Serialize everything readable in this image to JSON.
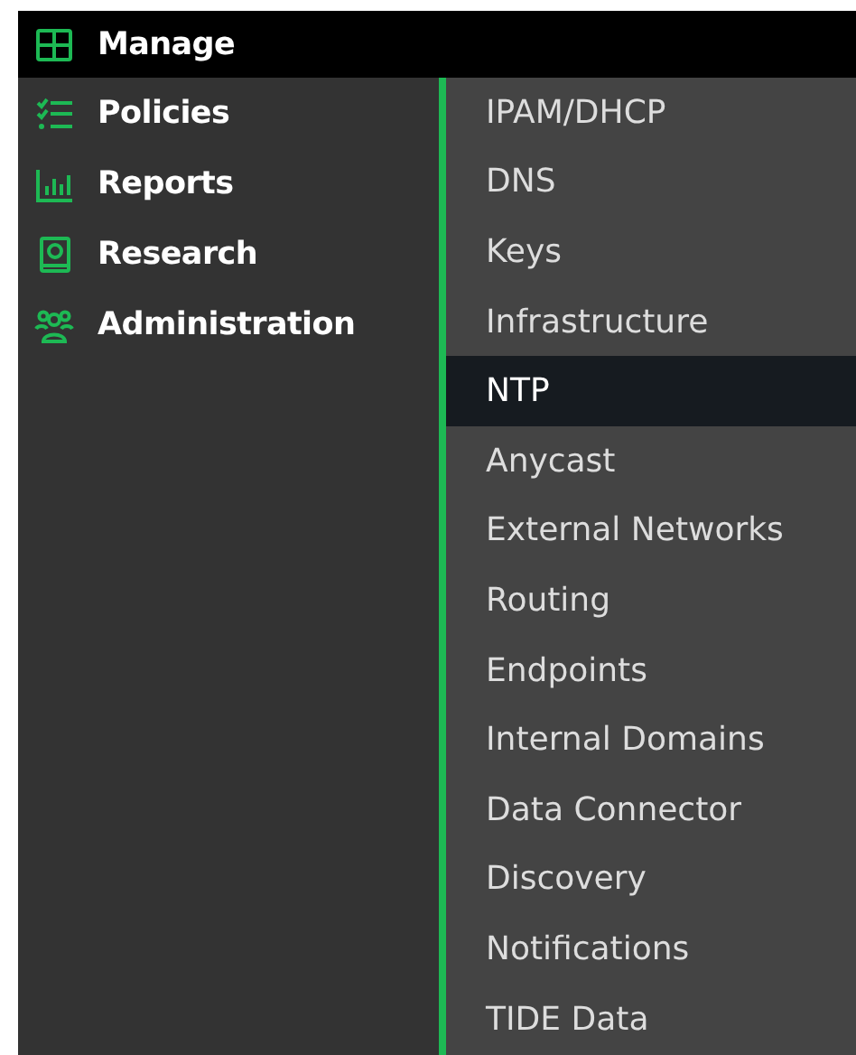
{
  "sidebar": {
    "items": [
      {
        "label": "Manage",
        "selected": true
      },
      {
        "label": "Policies",
        "selected": false
      },
      {
        "label": "Reports",
        "selected": false
      },
      {
        "label": "Research",
        "selected": false
      },
      {
        "label": "Administration",
        "selected": false
      }
    ]
  },
  "submenu": {
    "items": [
      {
        "label": "IPAM/DHCP",
        "selected": false
      },
      {
        "label": "DNS",
        "selected": false
      },
      {
        "label": "Keys",
        "selected": false
      },
      {
        "label": "Infrastructure",
        "selected": false
      },
      {
        "label": "NTP",
        "selected": true
      },
      {
        "label": "Anycast",
        "selected": false
      },
      {
        "label": "External Networks",
        "selected": false
      },
      {
        "label": "Routing",
        "selected": false
      },
      {
        "label": "Endpoints",
        "selected": false
      },
      {
        "label": "Internal Domains",
        "selected": false
      },
      {
        "label": "Data Connector",
        "selected": false
      },
      {
        "label": "Discovery",
        "selected": false
      },
      {
        "label": "Notifications",
        "selected": false
      },
      {
        "label": "TIDE Data",
        "selected": false
      }
    ]
  }
}
